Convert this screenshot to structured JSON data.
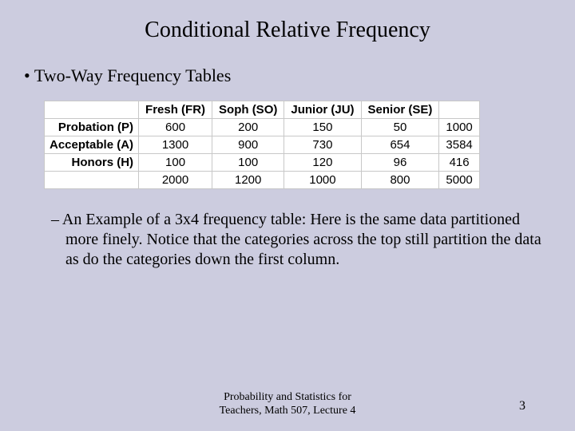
{
  "title": "Conditional Relative Frequency",
  "bullet": "Two-Way Frequency Tables",
  "chart_data": {
    "type": "table",
    "columns": [
      "Fresh (FR)",
      "Soph (SO)",
      "Junior (JU)",
      "Senior (SE)"
    ],
    "rows": [
      "Probation (P)",
      "Acceptable (A)",
      "Honors (H)"
    ],
    "values": [
      [
        600,
        200,
        150,
        50
      ],
      [
        1300,
        900,
        730,
        654
      ],
      [
        100,
        100,
        120,
        96
      ]
    ],
    "row_totals": [
      1000,
      3584,
      416
    ],
    "col_totals": [
      2000,
      1200,
      1000,
      800
    ],
    "grand_total": 5000
  },
  "description": "– An Example of a 3x4 frequency table: Here is the same data partitioned more finely. Notice that the categories across the top still partition the data as do the categories down the first column.",
  "footer": "Probability and Statistics for Teachers, Math 507, Lecture 4",
  "page": "3"
}
